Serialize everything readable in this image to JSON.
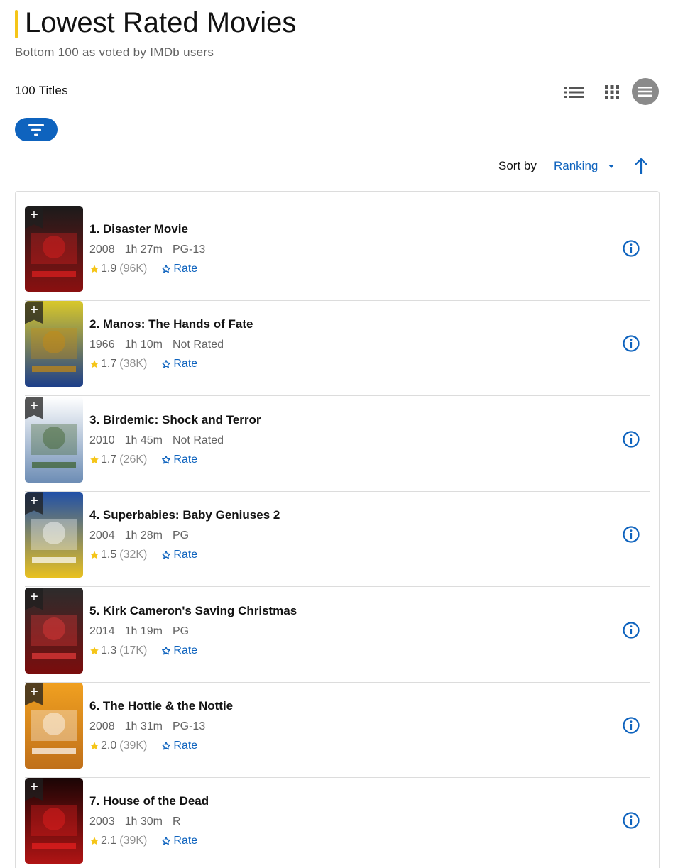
{
  "header": {
    "title": "Lowest Rated Movies",
    "subtitle": "Bottom 100 as voted by IMDb users",
    "accent_color": "#f5c518"
  },
  "toolbar": {
    "count_label": "100 Titles",
    "views": [
      {
        "name": "detailed-view",
        "icon": "list-icon"
      },
      {
        "name": "grid-view",
        "icon": "grid-icon"
      },
      {
        "name": "compact-view",
        "icon": "menu-icon",
        "selected": true
      }
    ],
    "filter_icon": "filter-icon",
    "sort_label": "Sort by",
    "sort_value": "Ranking",
    "sort_direction": "ascending",
    "link_color": "#0e63be"
  },
  "movies": [
    {
      "title": "1. Disaster Movie",
      "year": "2008",
      "runtime": "1h 27m",
      "certificate": "PG-13",
      "rating": "1.9",
      "votes": "(96K)",
      "rate_label": "Rate"
    },
    {
      "title": "2. Manos: The Hands of Fate",
      "year": "1966",
      "runtime": "1h 10m",
      "certificate": "Not Rated",
      "rating": "1.7",
      "votes": "(38K)",
      "rate_label": "Rate"
    },
    {
      "title": "3. Birdemic: Shock and Terror",
      "year": "2010",
      "runtime": "1h 45m",
      "certificate": "Not Rated",
      "rating": "1.7",
      "votes": "(26K)",
      "rate_label": "Rate"
    },
    {
      "title": "4. Superbabies: Baby Geniuses 2",
      "year": "2004",
      "runtime": "1h 28m",
      "certificate": "PG",
      "rating": "1.5",
      "votes": "(32K)",
      "rate_label": "Rate"
    },
    {
      "title": "5. Kirk Cameron's Saving Christmas",
      "year": "2014",
      "runtime": "1h 19m",
      "certificate": "PG",
      "rating": "1.3",
      "votes": "(17K)",
      "rate_label": "Rate"
    },
    {
      "title": "6. The Hottie & the Nottie",
      "year": "2008",
      "runtime": "1h 31m",
      "certificate": "PG-13",
      "rating": "2.0",
      "votes": "(39K)",
      "rate_label": "Rate"
    },
    {
      "title": "7. House of the Dead",
      "year": "2003",
      "runtime": "1h 30m",
      "certificate": "R",
      "rating": "2.1",
      "votes": "(39K)",
      "rate_label": "Rate"
    }
  ],
  "star_color": "#f5c518"
}
